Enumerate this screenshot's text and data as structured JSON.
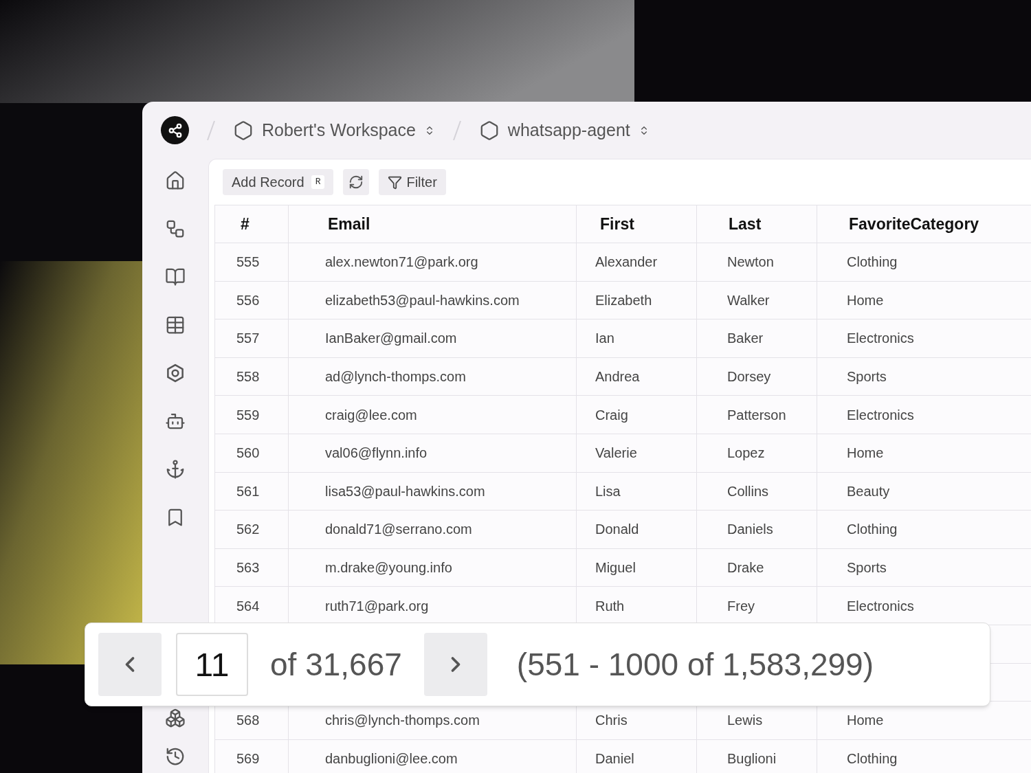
{
  "breadcrumbs": [
    {
      "label": "Robert's Workspace"
    },
    {
      "label": "whatsapp-agent"
    }
  ],
  "sidebar": {
    "items": [
      {
        "kind": "home"
      },
      {
        "kind": "workflow"
      },
      {
        "kind": "book"
      },
      {
        "kind": "table"
      },
      {
        "kind": "nut"
      },
      {
        "kind": "bot"
      },
      {
        "kind": "anchor"
      },
      {
        "kind": "bookmark"
      }
    ],
    "bottom_items": [
      {
        "kind": "boxes"
      },
      {
        "kind": "history"
      }
    ]
  },
  "toolbar": {
    "add_record": {
      "label": "Add Record",
      "shortcut": "R"
    },
    "filter": {
      "label": "Filter"
    }
  },
  "table": {
    "columns": [
      "#",
      "Email",
      "First",
      "Last",
      "FavoriteCategory"
    ],
    "rows": [
      [
        "555",
        "alex.newton71@park.org",
        "Alexander",
        "Newton",
        "Clothing"
      ],
      [
        "556",
        "elizabeth53@paul-hawkins.com",
        "Elizabeth",
        "Walker",
        "Home"
      ],
      [
        "557",
        "IanBaker@gmail.com",
        "Ian",
        "Baker",
        "Electronics"
      ],
      [
        "558",
        "ad@lynch-thomps.com",
        "Andrea",
        "Dorsey",
        "Sports"
      ],
      [
        "559",
        "craig@lee.com",
        "Craig",
        "Patterson",
        "Electronics"
      ],
      [
        "560",
        "val06@flynn.info",
        "Valerie",
        "Lopez",
        "Home"
      ],
      [
        "561",
        "lisa53@paul-hawkins.com",
        "Lisa",
        "Collins",
        "Beauty"
      ],
      [
        "562",
        "donald71@serrano.com",
        "Donald",
        "Daniels",
        "Clothing"
      ],
      [
        "563",
        "m.drake@young.info",
        "Miguel",
        "Drake",
        "Sports"
      ],
      [
        "564",
        "ruth71@park.org",
        "Ruth",
        "Frey",
        "Electronics"
      ]
    ],
    "rows_after_pager": [
      [
        "568",
        "chris@lynch-thomps.com",
        "Chris",
        "Lewis",
        "Home"
      ],
      [
        "569",
        "danbuglioni@lee.com",
        "Daniel",
        "Buglioni",
        "Clothing"
      ]
    ]
  },
  "pagination": {
    "page": "11",
    "of_pages": "of 31,667",
    "range": "(551 - 1000 of 1,583,299)"
  }
}
